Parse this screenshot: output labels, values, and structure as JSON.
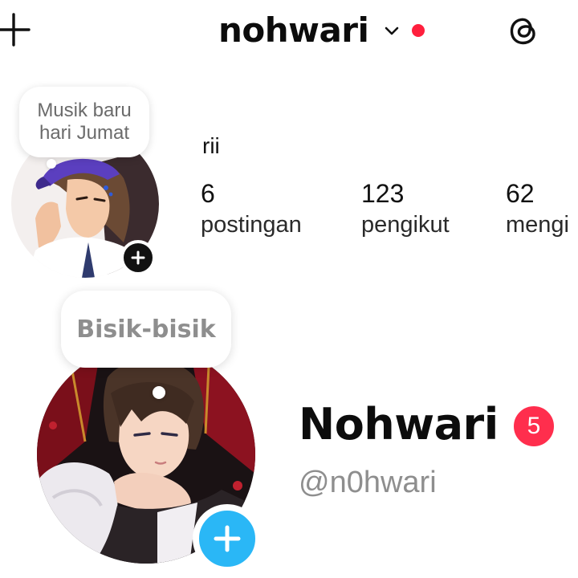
{
  "top_bar": {
    "username": "nohwari",
    "icons": {
      "add": "plus-icon",
      "switcher": "chevron-down-icon",
      "threads": "threads-icon"
    },
    "notification_dot_color": "#ff1f3d"
  },
  "profile_summary": {
    "note": [
      "Musik baru",
      "hari Jumat"
    ],
    "display_name": "rii",
    "stats": [
      {
        "value": "6",
        "label": "postingan"
      },
      {
        "value": "123",
        "label": "pengikut"
      },
      {
        "value": "62",
        "label": "mengi"
      }
    ]
  },
  "profile_card": {
    "note": "Bisik-bisik",
    "display_name": "Nohwari",
    "badge_count": "5",
    "handle": "@n0hwari",
    "colors": {
      "badge": "#ff2e4d",
      "add_story": "#2ab7f6"
    }
  }
}
